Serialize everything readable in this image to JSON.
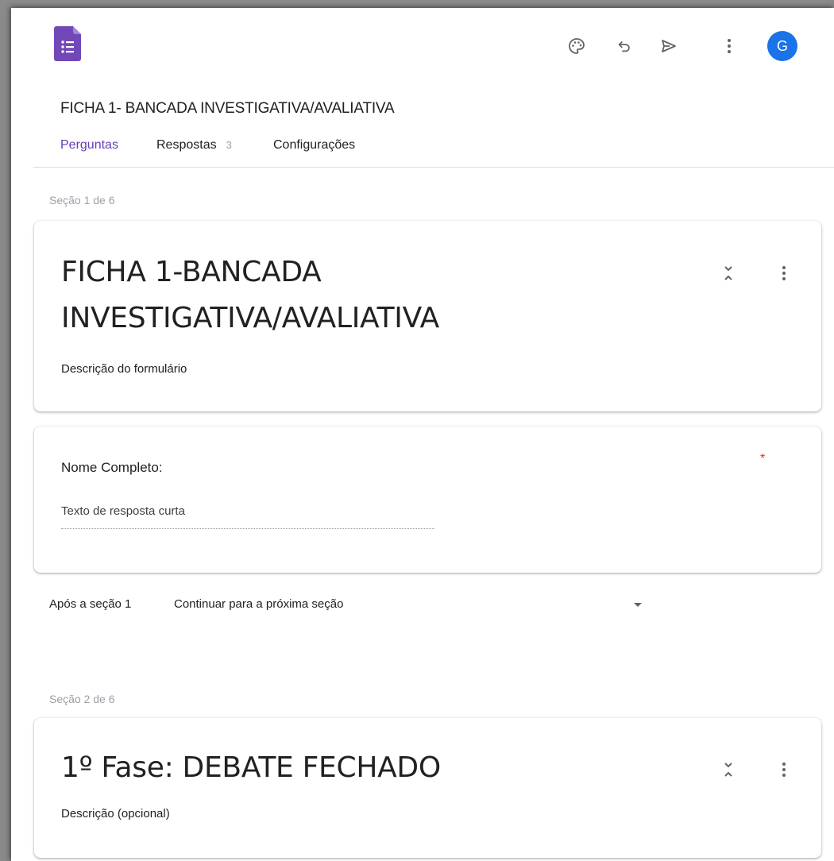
{
  "header": {
    "app_icon": "google-forms-icon",
    "toolbar": {
      "palette_icon": "palette-icon",
      "undo_icon": "undo-icon",
      "send_icon": "send-icon",
      "more_icon": "more-vertical-icon"
    },
    "avatar_letter": "G",
    "avatar_color": "#1a73e8"
  },
  "form_title": "FICHA 1- BANCADA INVESTIGATIVA/AVALIATIVA",
  "tabs": [
    {
      "label": "Perguntas",
      "active": true
    },
    {
      "label": "Respostas",
      "count": "3"
    },
    {
      "label": "Configurações"
    }
  ],
  "sections": [
    {
      "label": "Seção 1 de 6",
      "title_line1": "FICHA 1-BANCADA",
      "title_line2": "INVESTIGATIVA/AVALIATIVA",
      "description": "Descrição do formulário",
      "question": {
        "title": "Nome Completo:",
        "required_mark": "*",
        "answer_placeholder": "Texto de resposta curta"
      },
      "after_section": {
        "label": "Após a seção 1",
        "value": "Continuar para a próxima seção"
      }
    },
    {
      "label": "Seção 2 de 6",
      "title": "1º Fase: DEBATE FECHADO",
      "description": "Descrição (opcional)"
    }
  ],
  "colors": {
    "accent": "#673ab7",
    "required": "#d93025",
    "forms_purple": "#7248b9"
  }
}
